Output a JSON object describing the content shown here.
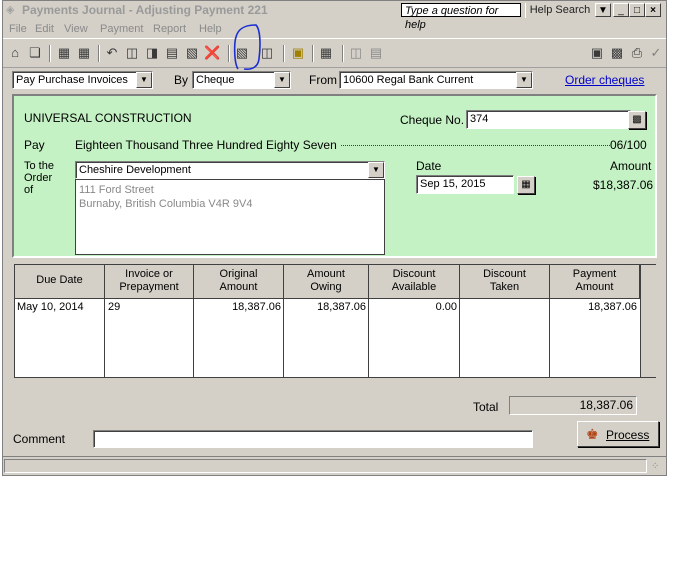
{
  "window": {
    "title": "Payments Journal - Adjusting Payment 221",
    "help_box": "Type a question for help",
    "help_search": "Help Search"
  },
  "menu": [
    "File",
    "Edit",
    "View",
    "Payment",
    "Report",
    "Help"
  ],
  "toolbar_icons": [
    "home-icon",
    "window-icon",
    "calendar-icon",
    "calendar-alt-icon",
    "undo-icon",
    "adjust-icon",
    "recall-icon",
    "table-icon",
    "cancel-icon",
    "reverse-icon",
    "lookup-icon",
    "track-icon",
    "calculator-icon",
    "fill-icon",
    "time-slip-icon"
  ],
  "toolbar_right_icons": [
    "open-icon",
    "preview-icon",
    "print-icon",
    "post-check-icon"
  ],
  "controls": {
    "transaction_type": "Pay Purchase Invoices",
    "by_label": "By",
    "method": "Cheque",
    "from_label": "From",
    "account": "10600 Regal Bank Current",
    "order_link": "Order cheques"
  },
  "cheque": {
    "company": "UNIVERSAL CONSTRUCTION",
    "cheque_no_label": "Cheque No.",
    "cheque_no": "374",
    "pay_label": "Pay",
    "pay_words": "Eighteen Thousand Three Hundred Eighty Seven",
    "cents": "06/100",
    "to_the_label": "To the",
    "order_label": "Order",
    "of_label": "of",
    "payee": "Cheshire Development",
    "address_line1": "111 Ford Street",
    "address_line2": "Burnaby, British Columbia V4R 9V4",
    "date_label": "Date",
    "date": "Sep 15, 2015",
    "amount_label": "Amount",
    "amount": "$18,387.06"
  },
  "table": {
    "headers": [
      [
        "Due Date",
        ""
      ],
      [
        "Invoice or",
        "Prepayment"
      ],
      [
        "Original",
        "Amount"
      ],
      [
        "Amount",
        "Owing"
      ],
      [
        "Discount",
        "Available"
      ],
      [
        "Discount",
        "Taken"
      ],
      [
        "Payment",
        "Amount"
      ]
    ],
    "rows": [
      [
        "May 10, 2014",
        "29",
        "18,387.06",
        "18,387.06",
        "0.00",
        "",
        "18,387.06"
      ]
    ]
  },
  "footer": {
    "total_label": "Total",
    "total": "18,387.06",
    "comment_label": "Comment",
    "comment": "",
    "process_label": "Process"
  }
}
